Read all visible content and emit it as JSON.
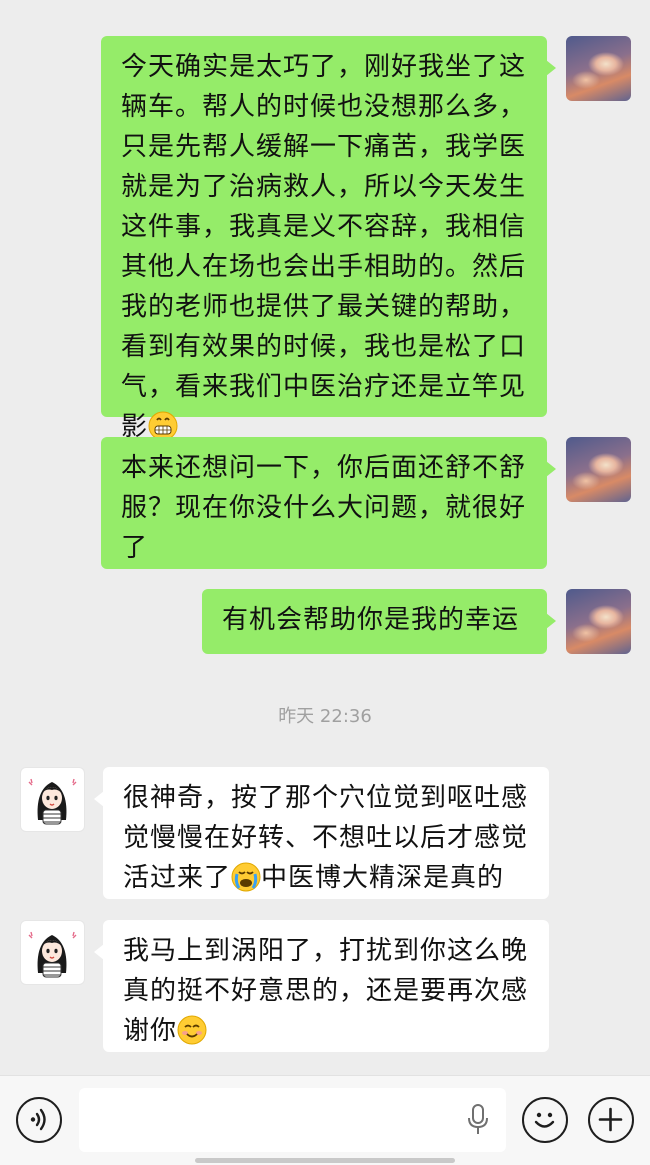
{
  "colors": {
    "sent_bubble": "#95ec69",
    "received_bubble": "#ffffff",
    "background": "#ededed"
  },
  "messages": [
    {
      "side": "sent",
      "lines": [
        "今天确实是太巧了，刚好我坐了这",
        "辆车。帮人的时候也没想那么多，",
        "只是先帮人缓解一下痛苦，我学医",
        "就是为了治病救人，所以今天发生",
        "这件事，我真是义不容辞，我相信",
        "其他人在场也会出手相助的。然后",
        "我的老师也提供了最关键的帮助，",
        "看到有效果的时候，我也是松了口",
        "气，看来我们中医治疗还是立竿见",
        "影"
      ],
      "emoji": "grinning-face-emoji"
    },
    {
      "side": "sent",
      "lines": [
        "本来还想问一下，你后面还舒不舒",
        "服？现在你没什么大问题，就很好",
        "了"
      ]
    },
    {
      "side": "sent",
      "lines": [
        "有机会帮助你是我的幸运"
      ]
    },
    {
      "side": "received",
      "lines": [
        "很神奇，按了那个穴位觉到呕吐感",
        "觉慢慢在好转、不想吐以后才感觉",
        "活过来了",
        "中医博大精深是真的"
      ],
      "emoji": "loudly-crying-face-emoji"
    },
    {
      "side": "received",
      "lines": [
        "我马上到涡阳了，打扰到你这么晚",
        "真的挺不好意思的，还是要再次感",
        "谢你"
      ],
      "emoji": "smiling-face-emoji"
    }
  ],
  "timestamp": "昨天 22:36",
  "input_bar": {
    "voice_icon": "voice-input-icon",
    "mic_icon": "microphone-icon",
    "emoji_icon": "emoji-button-icon",
    "plus_icon": "plus-icon"
  }
}
